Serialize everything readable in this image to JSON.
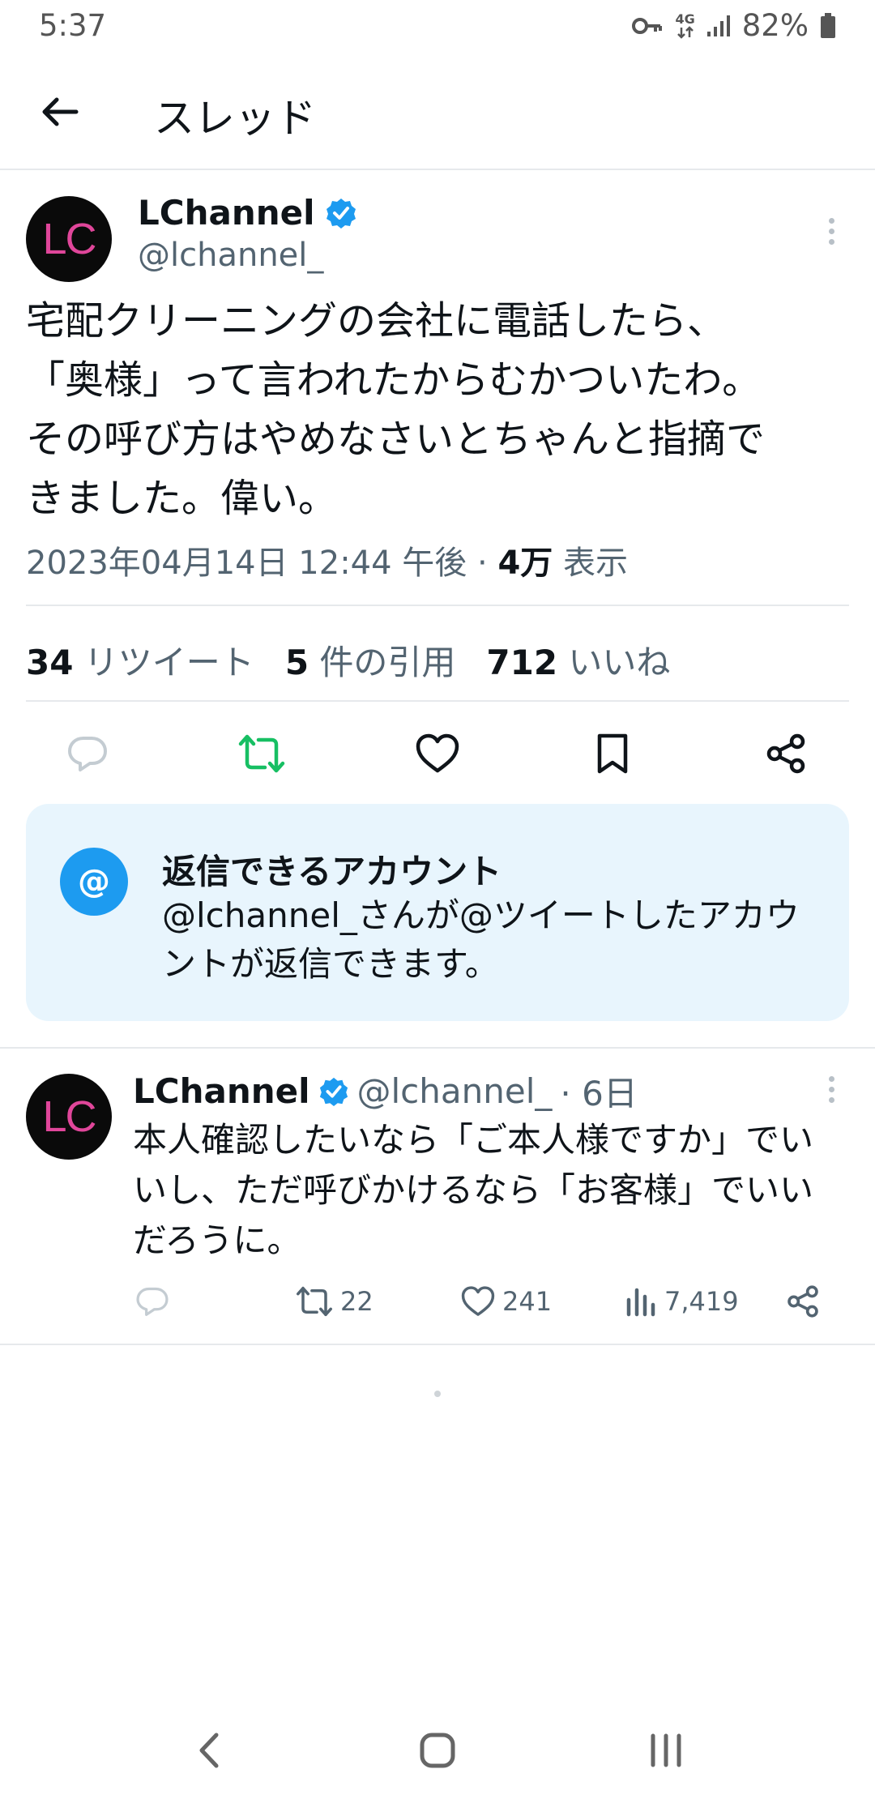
{
  "status_bar": {
    "time": "5:37",
    "network": "4G",
    "battery": "82%",
    "icons": [
      "key-icon",
      "network-4g-icon",
      "signal-icon",
      "battery-icon"
    ]
  },
  "header": {
    "title": "スレッド",
    "back_icon": "arrow-left-icon"
  },
  "main_tweet": {
    "author_name": "LChannel",
    "author_handle": "@lchannel_",
    "avatar_text": "LC",
    "verified": true,
    "text_lines": [
      "宅配クリーニングの会社に電話したら、",
      "「奥様」って言われたからむかついたわ。",
      "その呼び方はやめなさいとちゃんと指摘で",
      "きました。偉い。"
    ],
    "timestamp": "2023年04月14日 12:44 午後 · ",
    "views_count": "4万",
    "views_label": " 表示",
    "retweets_count": "34",
    "retweets_label": " リツイート",
    "quotes_count": "5",
    "quotes_label": " 件の引用",
    "likes_count": "712",
    "likes_label": " いいね",
    "actions": [
      "reply-icon",
      "retweet-icon",
      "like-icon",
      "bookmark-icon",
      "share-icon"
    ]
  },
  "reply_restriction": {
    "icon_symbol": "@",
    "title": "返信できるアカウント",
    "description_lines": [
      "@lchannel_さんが@ツイートしたアカウ",
      "ントが返信できます。"
    ]
  },
  "reply_tweet": {
    "author_name": "LChannel",
    "author_handle": "@lchannel_",
    "time_ago": " · 6日",
    "avatar_text": "LC",
    "verified": true,
    "text_lines": [
      "本人確認したいなら「ご本人様ですか」でい",
      "いし、ただ呼びかけるなら「お客様」でいい",
      "だろうに。"
    ],
    "retweets": "22",
    "likes": "241",
    "views": "7,419"
  },
  "colors": {
    "accent": "#1d9bf0",
    "text_primary": "#0f1419",
    "text_secondary": "#536471",
    "reply_box_bg": "#e8f5fd",
    "avatar_bg": "#0a0a0a",
    "avatar_text": "#e0469a",
    "retweet_icon": "#17bf63"
  }
}
